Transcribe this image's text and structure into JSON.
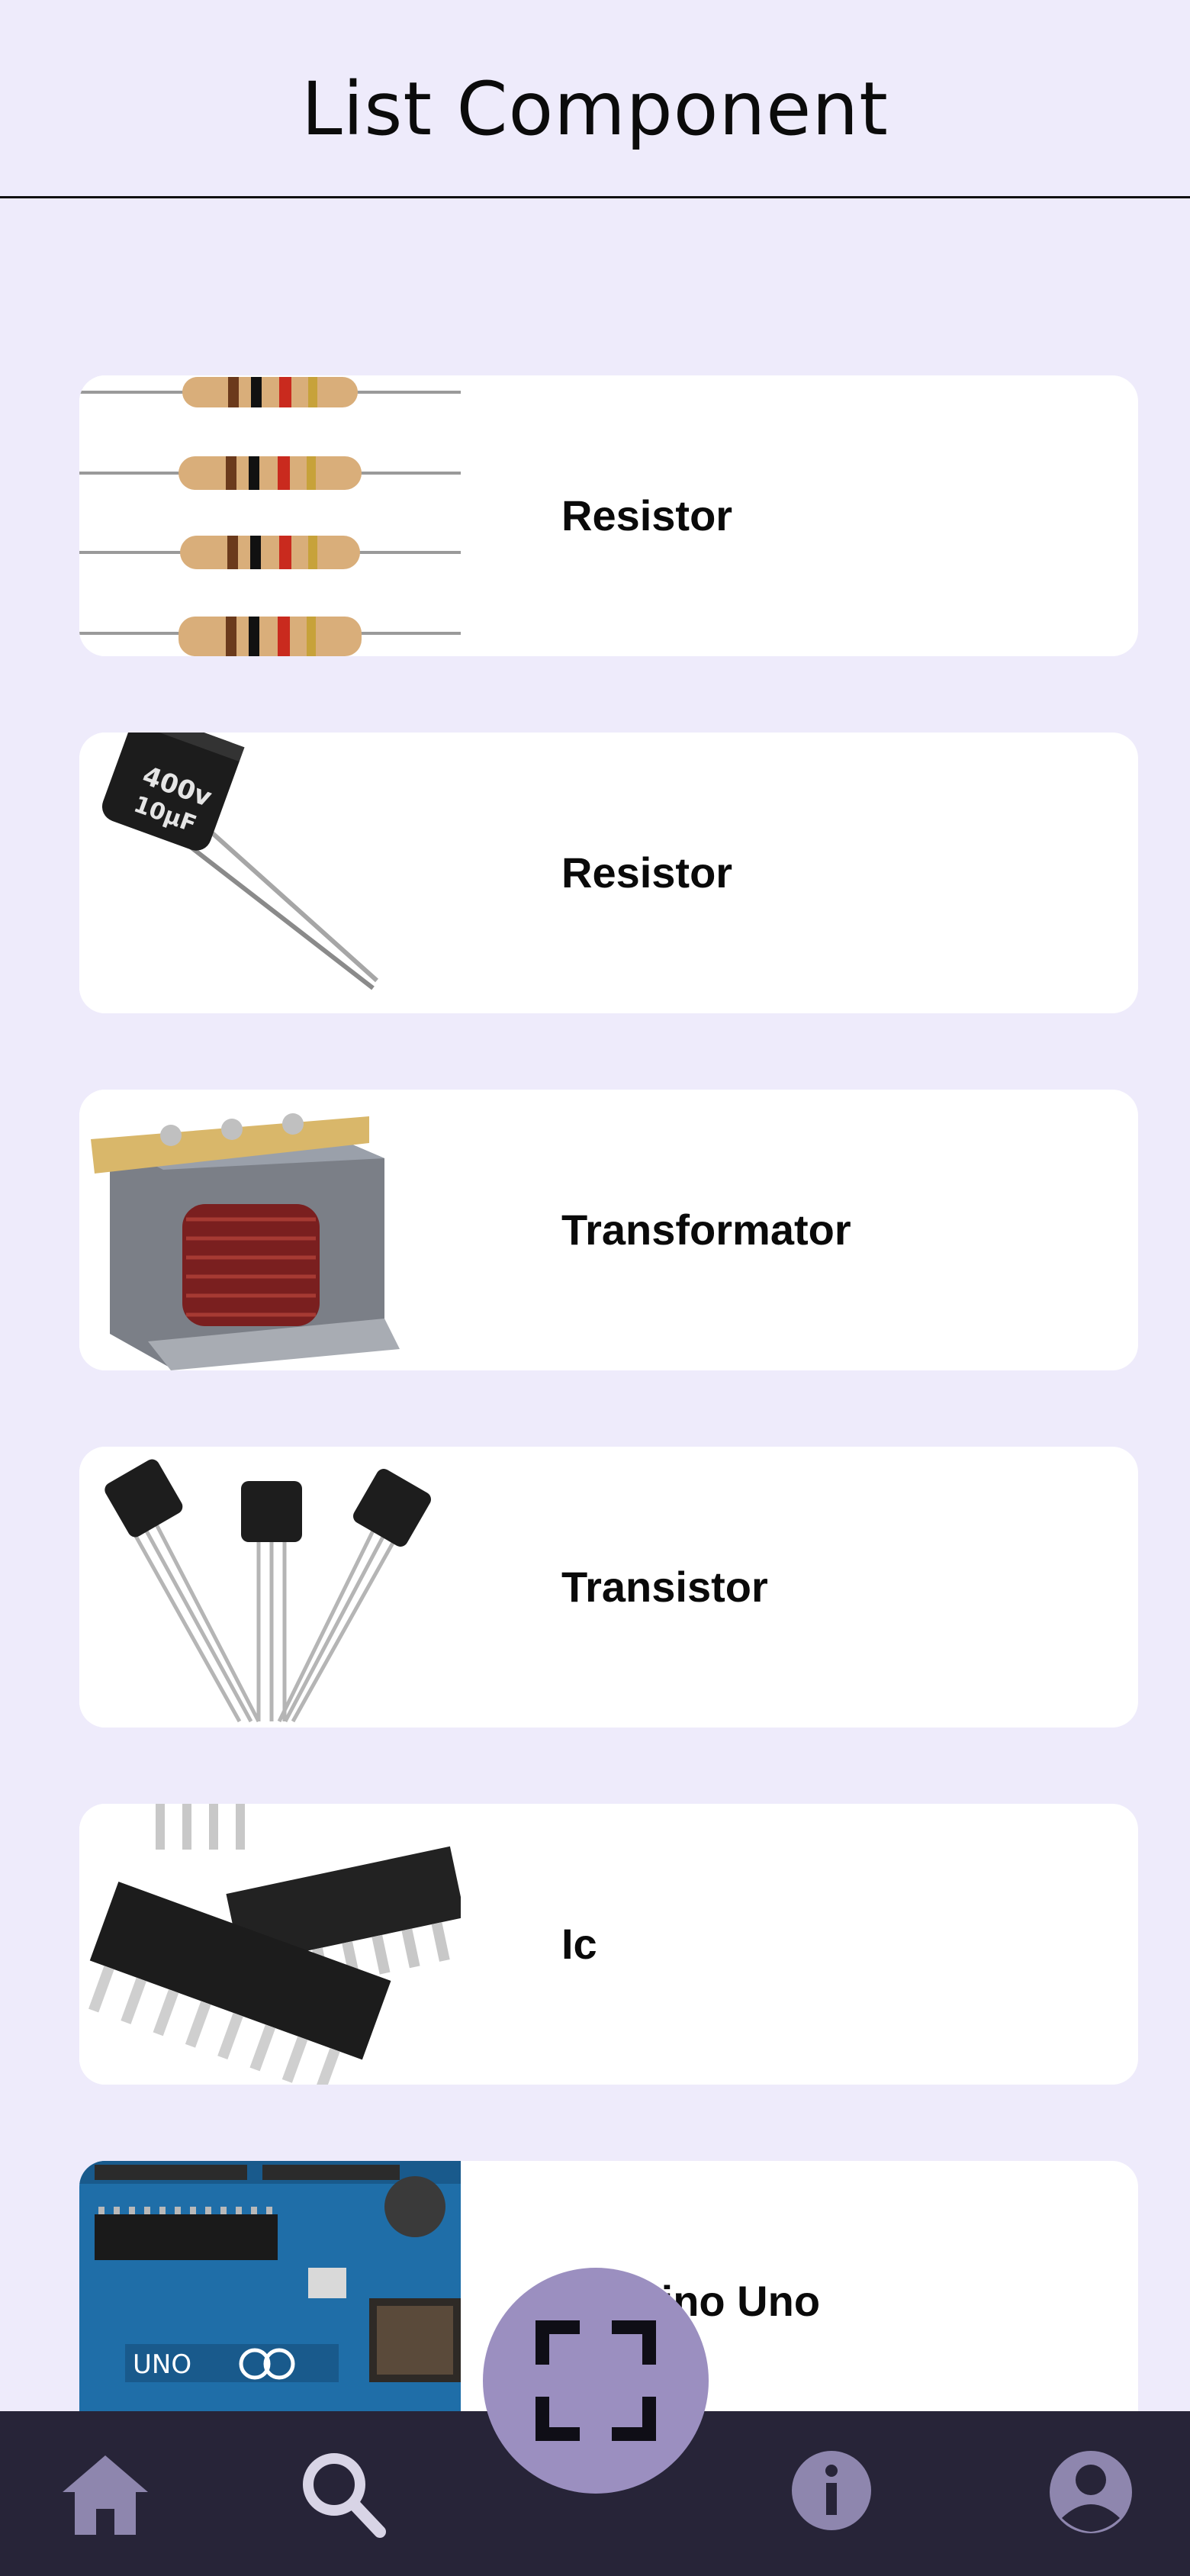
{
  "header": {
    "title": "List Component"
  },
  "components": [
    {
      "label": "Resistor",
      "image": "resistor-photo"
    },
    {
      "label": "Resistor",
      "image": "capacitor-photo"
    },
    {
      "label": "Transformator",
      "image": "transformer-photo"
    },
    {
      "label": "Transistor",
      "image": "transistor-photo"
    },
    {
      "label": "Ic",
      "image": "ic-chip-photo"
    },
    {
      "label": "Arduino Uno",
      "image": "arduino-board-photo"
    }
  ],
  "bottom_nav": {
    "items": [
      {
        "icon": "home-icon"
      },
      {
        "icon": "search-icon"
      },
      {
        "icon": "info-icon"
      },
      {
        "icon": "account-icon"
      }
    ],
    "fab_icon": "scan-icon"
  },
  "colors": {
    "background": "#EEEBFB",
    "card": "#FFFFFF",
    "nav_background": "#272438",
    "nav_icon": "#8E86AE",
    "fab": "#9B8FC0"
  }
}
